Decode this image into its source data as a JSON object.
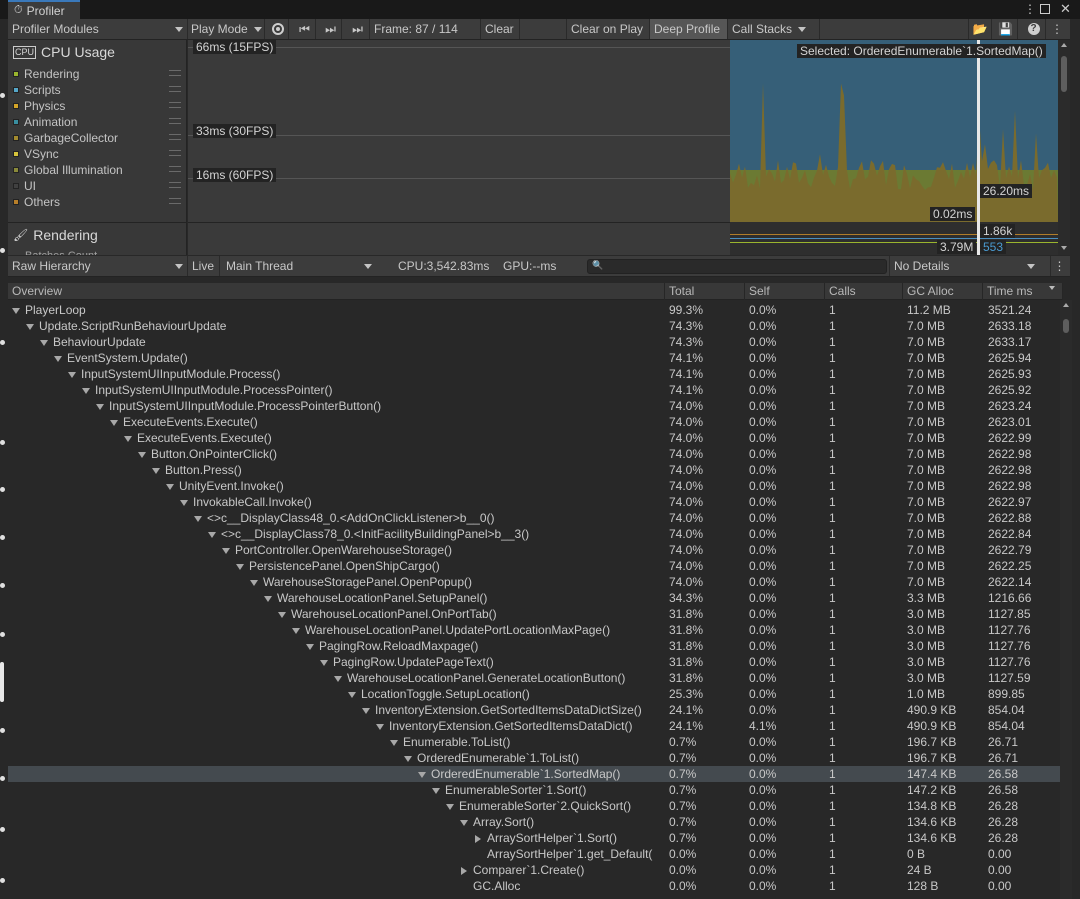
{
  "window": {
    "title": "Profiler"
  },
  "toolbar": {
    "modules_label": "Profiler Modules",
    "play_mode_label": "Play Mode",
    "frame_label": "Frame: 87 / 114",
    "clear_label": "Clear",
    "clear_on_play_label": "Clear on Play",
    "deep_profile_label": "Deep Profile",
    "call_stacks_label": "Call Stacks"
  },
  "cpu_module": {
    "title": "CPU Usage",
    "legend": [
      {
        "label": "Rendering",
        "color": "#9ab52e"
      },
      {
        "label": "Scripts",
        "color": "#56a7c8"
      },
      {
        "label": "Physics",
        "color": "#d4a528"
      },
      {
        "label": "Animation",
        "color": "#3a8fa0"
      },
      {
        "label": "GarbageCollector",
        "color": "#a38b2e"
      },
      {
        "label": "VSync",
        "color": "#d6c43c"
      },
      {
        "label": "Global Illumination",
        "color": "#8a8a3a"
      },
      {
        "label": "UI",
        "color": "#404040"
      },
      {
        "label": "Others",
        "color": "#b87f2a"
      }
    ]
  },
  "rendering_module": {
    "title": "Rendering",
    "partial_label": "Batches Count"
  },
  "chart": {
    "line_66": "66ms (15FPS)",
    "line_33": "33ms (30FPS)",
    "line_16": "16ms (60FPS)",
    "selected_label": "Selected: OrderedEnumerable`1.SortedMap()",
    "value_main": "26.20ms",
    "value_low": "0.02ms",
    "render_val1": "1.86k",
    "render_val2": "3.79M",
    "render_val3": "553"
  },
  "hierarchy_bar": {
    "view_label": "Raw Hierarchy",
    "live_label": "Live",
    "thread_label": "Main Thread",
    "cpu_label": "CPU:3,542.83ms",
    "gpu_label": "GPU:--ms",
    "search_placeholder": "",
    "details_label": "No Details"
  },
  "columns": [
    "Overview",
    "Total",
    "Self",
    "Calls",
    "GC Alloc",
    "Time ms"
  ],
  "rows": [
    {
      "d": 0,
      "t": "open",
      "name": "PlayerLoop",
      "total": "99.3%",
      "self": "0.0%",
      "calls": "1",
      "gc": "11.2 MB",
      "time": "3521.24"
    },
    {
      "d": 1,
      "t": "open",
      "name": "Update.ScriptRunBehaviourUpdate",
      "total": "74.3%",
      "self": "0.0%",
      "calls": "1",
      "gc": "7.0 MB",
      "time": "2633.18"
    },
    {
      "d": 2,
      "t": "open",
      "name": "BehaviourUpdate",
      "total": "74.3%",
      "self": "0.0%",
      "calls": "1",
      "gc": "7.0 MB",
      "time": "2633.17"
    },
    {
      "d": 3,
      "t": "open",
      "name": "EventSystem.Update()",
      "total": "74.1%",
      "self": "0.0%",
      "calls": "1",
      "gc": "7.0 MB",
      "time": "2625.94"
    },
    {
      "d": 4,
      "t": "open",
      "name": "InputSystemUIInputModule.Process()",
      "total": "74.1%",
      "self": "0.0%",
      "calls": "1",
      "gc": "7.0 MB",
      "time": "2625.93"
    },
    {
      "d": 5,
      "t": "open",
      "name": "InputSystemUIInputModule.ProcessPointer()",
      "total": "74.1%",
      "self": "0.0%",
      "calls": "1",
      "gc": "7.0 MB",
      "time": "2625.92"
    },
    {
      "d": 6,
      "t": "open",
      "name": "InputSystemUIInputModule.ProcessPointerButton()",
      "total": "74.0%",
      "self": "0.0%",
      "calls": "1",
      "gc": "7.0 MB",
      "time": "2623.24"
    },
    {
      "d": 7,
      "t": "open",
      "name": "ExecuteEvents.Execute()",
      "total": "74.0%",
      "self": "0.0%",
      "calls": "1",
      "gc": "7.0 MB",
      "time": "2623.01"
    },
    {
      "d": 8,
      "t": "open",
      "name": "ExecuteEvents.Execute()",
      "total": "74.0%",
      "self": "0.0%",
      "calls": "1",
      "gc": "7.0 MB",
      "time": "2622.99"
    },
    {
      "d": 9,
      "t": "open",
      "name": "Button.OnPointerClick()",
      "total": "74.0%",
      "self": "0.0%",
      "calls": "1",
      "gc": "7.0 MB",
      "time": "2622.98"
    },
    {
      "d": 10,
      "t": "open",
      "name": "Button.Press()",
      "total": "74.0%",
      "self": "0.0%",
      "calls": "1",
      "gc": "7.0 MB",
      "time": "2622.98"
    },
    {
      "d": 11,
      "t": "open",
      "name": "UnityEvent.Invoke()",
      "total": "74.0%",
      "self": "0.0%",
      "calls": "1",
      "gc": "7.0 MB",
      "time": "2622.98"
    },
    {
      "d": 12,
      "t": "open",
      "name": "InvokableCall.Invoke()",
      "total": "74.0%",
      "self": "0.0%",
      "calls": "1",
      "gc": "7.0 MB",
      "time": "2622.97"
    },
    {
      "d": 13,
      "t": "open",
      "name": "<>c__DisplayClass48_0.<AddOnClickListener>b__0()",
      "total": "74.0%",
      "self": "0.0%",
      "calls": "1",
      "gc": "7.0 MB",
      "time": "2622.88"
    },
    {
      "d": 14,
      "t": "open",
      "name": "<>c__DisplayClass78_0.<InitFacilityBuildingPanel>b__3()",
      "total": "74.0%",
      "self": "0.0%",
      "calls": "1",
      "gc": "7.0 MB",
      "time": "2622.84"
    },
    {
      "d": 15,
      "t": "open",
      "name": "PortController.OpenWarehouseStorage()",
      "total": "74.0%",
      "self": "0.0%",
      "calls": "1",
      "gc": "7.0 MB",
      "time": "2622.79"
    },
    {
      "d": 16,
      "t": "open",
      "name": "PersistencePanel.OpenShipCargo()",
      "total": "74.0%",
      "self": "0.0%",
      "calls": "1",
      "gc": "7.0 MB",
      "time": "2622.25"
    },
    {
      "d": 17,
      "t": "open",
      "name": "WarehouseStoragePanel.OpenPopup()",
      "total": "74.0%",
      "self": "0.0%",
      "calls": "1",
      "gc": "7.0 MB",
      "time": "2622.14"
    },
    {
      "d": 18,
      "t": "open",
      "name": "WarehouseLocationPanel.SetupPanel()",
      "total": "34.3%",
      "self": "0.0%",
      "calls": "1",
      "gc": "3.3 MB",
      "time": "1216.66"
    },
    {
      "d": 19,
      "t": "open",
      "name": "WarehouseLocationPanel.OnPortTab()",
      "total": "31.8%",
      "self": "0.0%",
      "calls": "1",
      "gc": "3.0 MB",
      "time": "1127.85"
    },
    {
      "d": 20,
      "t": "open",
      "name": "WarehouseLocationPanel.UpdatePortLocationMaxPage()",
      "total": "31.8%",
      "self": "0.0%",
      "calls": "1",
      "gc": "3.0 MB",
      "time": "1127.76"
    },
    {
      "d": 21,
      "t": "open",
      "name": "PagingRow.ReloadMaxpage()",
      "total": "31.8%",
      "self": "0.0%",
      "calls": "1",
      "gc": "3.0 MB",
      "time": "1127.76"
    },
    {
      "d": 22,
      "t": "open",
      "name": "PagingRow.UpdatePageText()",
      "total": "31.8%",
      "self": "0.0%",
      "calls": "1",
      "gc": "3.0 MB",
      "time": "1127.76"
    },
    {
      "d": 23,
      "t": "open",
      "name": "WarehouseLocationPanel.GenerateLocationButton()",
      "total": "31.8%",
      "self": "0.0%",
      "calls": "1",
      "gc": "3.0 MB",
      "time": "1127.59"
    },
    {
      "d": 24,
      "t": "open",
      "name": "LocationToggle.SetupLocation()",
      "total": "25.3%",
      "self": "0.0%",
      "calls": "1",
      "gc": "1.0 MB",
      "time": "899.85"
    },
    {
      "d": 25,
      "t": "open",
      "name": "InventoryExtension.GetSortedItemsDataDictSize()",
      "total": "24.1%",
      "self": "0.0%",
      "calls": "1",
      "gc": "490.9 KB",
      "time": "854.04"
    },
    {
      "d": 26,
      "t": "open",
      "name": "InventoryExtension.GetSortedItemsDataDict()",
      "total": "24.1%",
      "self": "4.1%",
      "calls": "1",
      "gc": "490.9 KB",
      "time": "854.04"
    },
    {
      "d": 27,
      "t": "open",
      "name": "Enumerable.ToList()",
      "total": "0.7%",
      "self": "0.0%",
      "calls": "1",
      "gc": "196.7 KB",
      "time": "26.71"
    },
    {
      "d": 28,
      "t": "open",
      "name": "OrderedEnumerable`1.ToList()",
      "total": "0.7%",
      "self": "0.0%",
      "calls": "1",
      "gc": "196.7 KB",
      "time": "26.71"
    },
    {
      "d": 29,
      "t": "open",
      "name": "OrderedEnumerable`1.SortedMap()",
      "total": "0.7%",
      "self": "0.0%",
      "calls": "1",
      "gc": "147.4 KB",
      "time": "26.58",
      "sel": true
    },
    {
      "d": 30,
      "t": "open",
      "name": "EnumerableSorter`1.Sort()",
      "total": "0.7%",
      "self": "0.0%",
      "calls": "1",
      "gc": "147.2 KB",
      "time": "26.58"
    },
    {
      "d": 31,
      "t": "open",
      "name": "EnumerableSorter`2.QuickSort()",
      "total": "0.7%",
      "self": "0.0%",
      "calls": "1",
      "gc": "134.8 KB",
      "time": "26.28"
    },
    {
      "d": 32,
      "t": "open",
      "name": "Array.Sort()",
      "total": "0.7%",
      "self": "0.0%",
      "calls": "1",
      "gc": "134.6 KB",
      "time": "26.28"
    },
    {
      "d": 33,
      "t": "closed",
      "name": "ArraySortHelper`1.Sort()",
      "total": "0.7%",
      "self": "0.0%",
      "calls": "1",
      "gc": "134.6 KB",
      "time": "26.28"
    },
    {
      "d": 33,
      "t": "none",
      "name": "ArraySortHelper`1.get_Default(",
      "total": "0.0%",
      "self": "0.0%",
      "calls": "1",
      "gc": "0 B",
      "time": "0.00"
    },
    {
      "d": 32,
      "t": "closed",
      "name": "Comparer`1.Create()",
      "total": "0.0%",
      "self": "0.0%",
      "calls": "1",
      "gc": "24 B",
      "time": "0.00"
    },
    {
      "d": 32,
      "t": "none",
      "name": "GC.Alloc",
      "total": "0.0%",
      "self": "0.0%",
      "calls": "1",
      "gc": "128 B",
      "time": "0.00"
    }
  ]
}
